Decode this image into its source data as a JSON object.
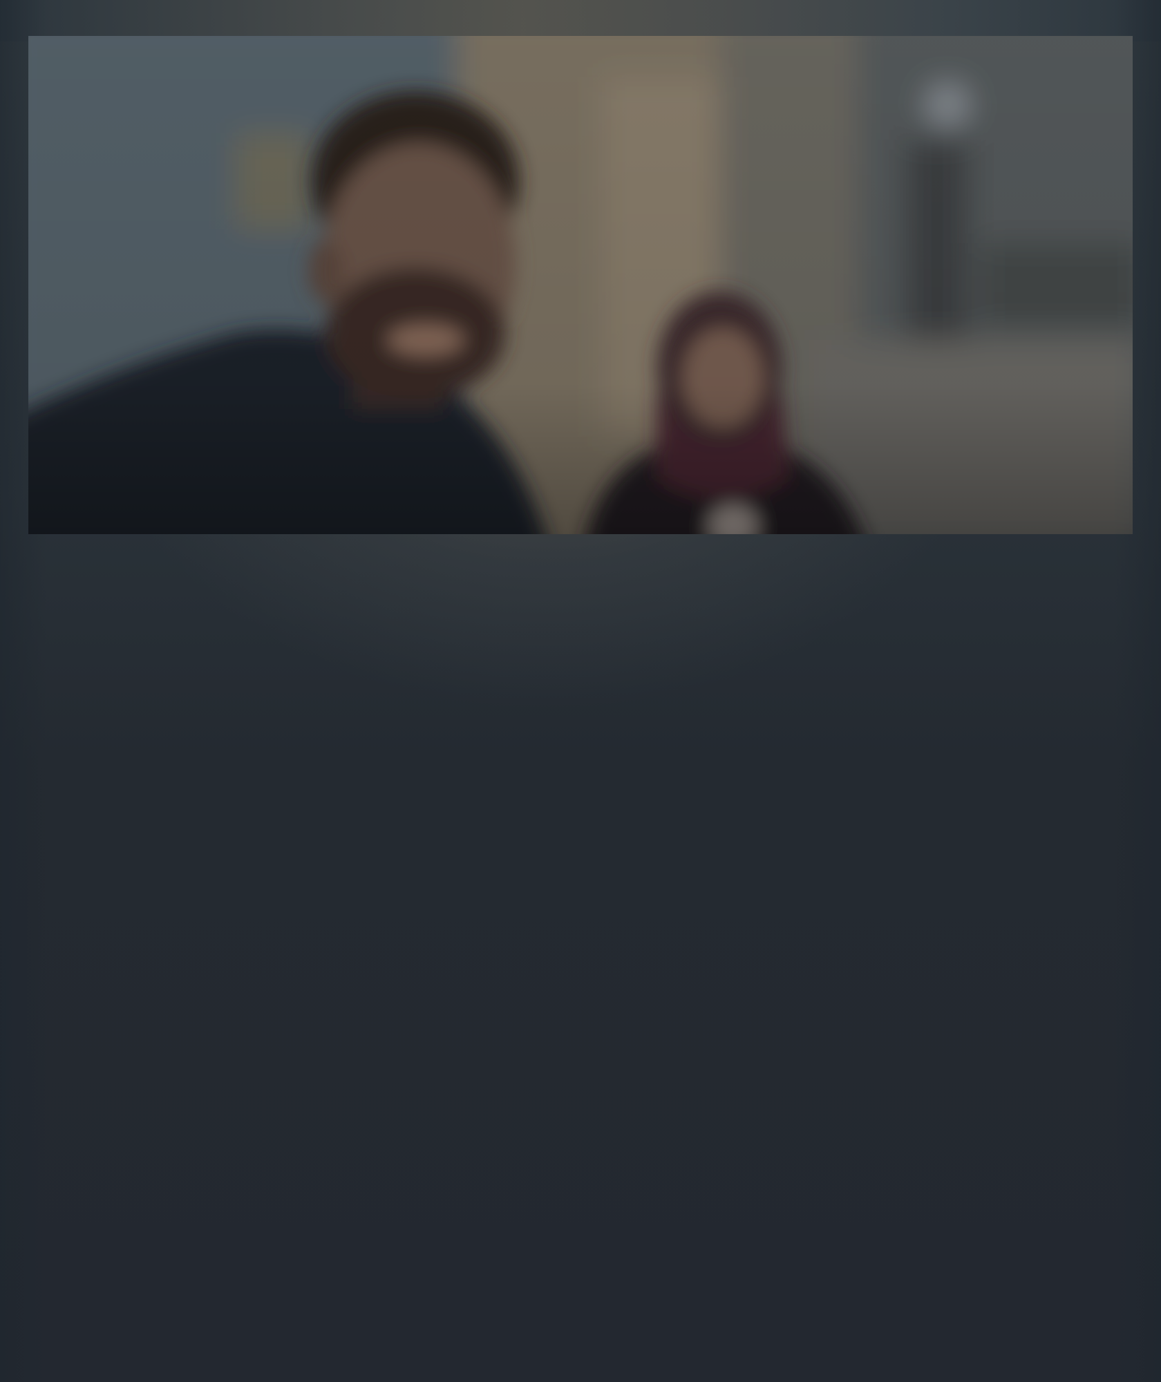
{
  "call": {
    "remote_video": {
      "label": ""
    }
  },
  "colors": {
    "background_top": "#313a40",
    "background_bottom": "#232830",
    "video_warm_tone": "#7a7163",
    "video_cool_tone": "#4c5961"
  },
  "icons": {
    "video_feed": "video-feed"
  }
}
